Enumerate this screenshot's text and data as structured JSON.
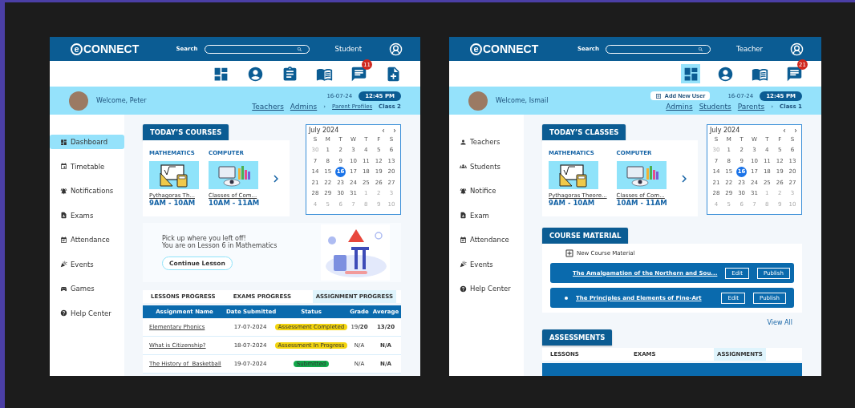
{
  "screens": [
    {
      "logo": {
        "mark": "e",
        "text": "CONNECT"
      },
      "search_label": "Search",
      "role": "Student",
      "toolbar": [
        {
          "kind": "dashboard",
          "selected": false
        },
        {
          "kind": "profile",
          "selected": false
        },
        {
          "kind": "tasks",
          "selected": false
        },
        {
          "kind": "book",
          "selected": false
        },
        {
          "kind": "chat",
          "selected": false,
          "badge": "11"
        },
        {
          "kind": "document",
          "selected": false
        }
      ],
      "welcome": "Welcome, Peter",
      "date": "16-07-24",
      "time": "12:45 PM",
      "crumbs": [
        {
          "kind": "link",
          "label": "Teachers"
        },
        {
          "kind": "link",
          "label": "Admins"
        },
        {
          "kind": "separator",
          "label": "›"
        },
        {
          "kind": "sublink",
          "label": "Parent Profiles"
        },
        {
          "kind": "text",
          "label": "Class 2"
        }
      ],
      "sidebar": [
        {
          "kind": "dashboard",
          "label": "Dashboard",
          "selected": true
        },
        {
          "kind": "timetable",
          "label": "Timetable",
          "selected": false
        },
        {
          "kind": "notifications",
          "label": "Notifications",
          "selected": false
        },
        {
          "kind": "exams",
          "label": "Exams",
          "selected": false
        },
        {
          "kind": "attendance",
          "label": "Attendance",
          "selected": false
        },
        {
          "kind": "events",
          "label": "Events",
          "selected": false
        },
        {
          "kind": "games",
          "label": "Games",
          "selected": false
        },
        {
          "kind": "help",
          "label": "Help Center",
          "selected": false
        }
      ],
      "courses": {
        "title": "TODAY’S COURSES",
        "items": [
          {
            "kind": "math",
            "subject": "MATHEMATICS",
            "title": "Pythagoras Th...",
            "time": "9AM - 10AM"
          },
          {
            "kind": "computer",
            "subject": "COMPUTER",
            "title": "Classes of Com...",
            "time": "10AM - 11AM"
          }
        ]
      },
      "calendar": {
        "month": "July 2024",
        "weekdays": [
          "S",
          "M",
          "T",
          "W",
          "T",
          "F",
          "S"
        ],
        "leading": [
          "30"
        ],
        "days": [
          {
            "label": "1",
            "selected": false
          },
          {
            "label": "2",
            "selected": false
          },
          {
            "label": "3",
            "selected": false
          },
          {
            "label": "4",
            "selected": false
          },
          {
            "label": "5",
            "selected": false
          },
          {
            "label": "6",
            "selected": false
          },
          {
            "label": "7",
            "selected": false
          },
          {
            "label": "8",
            "selected": false
          },
          {
            "label": "9",
            "selected": false
          },
          {
            "label": "10",
            "selected": false
          },
          {
            "label": "11",
            "selected": false
          },
          {
            "label": "12",
            "selected": false
          },
          {
            "label": "13",
            "selected": false
          },
          {
            "label": "14",
            "selected": false
          },
          {
            "label": "15",
            "selected": false
          },
          {
            "label": "16",
            "selected": true
          },
          {
            "label": "17",
            "selected": false
          },
          {
            "label": "18",
            "selected": false
          },
          {
            "label": "19",
            "selected": false
          },
          {
            "label": "20",
            "selected": false
          },
          {
            "label": "21",
            "selected": false
          },
          {
            "label": "22",
            "selected": false
          },
          {
            "label": "23",
            "selected": false
          },
          {
            "label": "24",
            "selected": false
          },
          {
            "label": "25",
            "selected": false
          },
          {
            "label": "26",
            "selected": false
          },
          {
            "label": "27",
            "selected": false
          },
          {
            "label": "28",
            "selected": false
          },
          {
            "label": "29",
            "selected": false
          },
          {
            "label": "30",
            "selected": false
          },
          {
            "label": "31",
            "selected": false
          }
        ],
        "trailing": [
          "1",
          "2",
          "3",
          "4",
          "5",
          "6",
          "7",
          "8",
          "9",
          "10"
        ]
      },
      "resume": {
        "lines": [
          "Pick up where you left off!",
          "You are on Lesson 6 in Mathematics"
        ],
        "button": "Continue Lesson"
      },
      "progress": {
        "tabs": [
          {
            "label": "LESSONS PROGRESS",
            "selected": false
          },
          {
            "label": "EXAMS PROGRESS",
            "selected": false
          },
          {
            "label": "ASSIGNMENT PROGRESS",
            "selected": true
          }
        ],
        "columns": [
          "Assignment Name",
          "Date Submitted",
          "Status",
          "Grade",
          "Average"
        ],
        "rows": [
          {
            "name": "Elementary Phonics",
            "date": "17-07-2024",
            "status": {
              "label": "Assessment Completed",
              "color": "#f2d40f"
            },
            "grade": "19**/20**",
            "average": "13/20"
          },
          {
            "name": "What is Citizenship?",
            "date": "18-07-2024",
            "status": {
              "label": "Assessment In Progress",
              "color": "#f2d40f"
            },
            "grade": "N/A",
            "average": "N/A"
          },
          {
            "name": "The History of  Basketball",
            "date": "19-07-2024",
            "status": {
              "label": "Submitted",
              "color": "#12a84a"
            },
            "grade": "N/A",
            "average": "N/A"
          }
        ]
      }
    },
    {
      "logo": {
        "mark": "e",
        "text": "CONNECT"
      },
      "search_label": "Search",
      "role": "Teacher",
      "toolbar": [
        {
          "kind": "dashboard",
          "selected": true
        },
        {
          "kind": "profile",
          "selected": false
        },
        {
          "kind": "book",
          "selected": false
        },
        {
          "kind": "chat",
          "selected": false,
          "badge": "21"
        }
      ],
      "welcome": "Welcome, Ismail",
      "add_user": "Add New User",
      "date": "16-07-24",
      "time": "12:45 PM",
      "crumbs": [
        {
          "kind": "link",
          "label": "Admins"
        },
        {
          "kind": "link",
          "label": "Students"
        },
        {
          "kind": "link",
          "label": "Parents"
        },
        {
          "kind": "separator",
          "label": "›"
        },
        {
          "kind": "text",
          "label": "Class 1"
        }
      ],
      "sidebar": [
        {
          "kind": "teachers",
          "label": "Teachers",
          "selected": false
        },
        {
          "kind": "students",
          "label": "Students",
          "selected": false
        },
        {
          "kind": "notifications",
          "label": "Notifice",
          "selected": false
        },
        {
          "kind": "exams",
          "label": "Exam",
          "selected": false
        },
        {
          "kind": "attendance",
          "label": "Attendance",
          "selected": false
        },
        {
          "kind": "events",
          "label": "Events",
          "selected": false
        },
        {
          "kind": "help",
          "label": "Help Center",
          "selected": false
        }
      ],
      "courses": {
        "title": "TODAY’S CLASSES",
        "items": [
          {
            "kind": "math",
            "subject": "MATHEMATICS",
            "title": "Pythagoras Theore...",
            "time": "9AM - 10AM"
          },
          {
            "kind": "computer",
            "subject": "COMPUTER",
            "title": "Classes of Com...",
            "time": "10AM - 11AM"
          }
        ]
      },
      "calendar": {
        "month": "July 2024",
        "weekdays": [
          "S",
          "M",
          "T",
          "W",
          "T",
          "F",
          "S"
        ],
        "leading": [
          "30"
        ],
        "days": [
          {
            "label": "1",
            "selected": false
          },
          {
            "label": "2",
            "selected": false
          },
          {
            "label": "3",
            "selected": false
          },
          {
            "label": "4",
            "selected": false
          },
          {
            "label": "5",
            "selected": false
          },
          {
            "label": "6",
            "selected": false
          },
          {
            "label": "7",
            "selected": false
          },
          {
            "label": "8",
            "selected": false
          },
          {
            "label": "9",
            "selected": false
          },
          {
            "label": "10",
            "selected": false
          },
          {
            "label": "11",
            "selected": false
          },
          {
            "label": "12",
            "selected": false
          },
          {
            "label": "13",
            "selected": false
          },
          {
            "label": "14",
            "selected": false
          },
          {
            "label": "15",
            "selected": false
          },
          {
            "label": "16",
            "selected": true
          },
          {
            "label": "17",
            "selected": false
          },
          {
            "label": "18",
            "selected": false
          },
          {
            "label": "19",
            "selected": false
          },
          {
            "label": "20",
            "selected": false
          },
          {
            "label": "21",
            "selected": false
          },
          {
            "label": "22",
            "selected": false
          },
          {
            "label": "23",
            "selected": false
          },
          {
            "label": "24",
            "selected": false
          },
          {
            "label": "25",
            "selected": false
          },
          {
            "label": "26",
            "selected": false
          },
          {
            "label": "27",
            "selected": false
          },
          {
            "label": "28",
            "selected": false
          },
          {
            "label": "29",
            "selected": false
          },
          {
            "label": "30",
            "selected": false
          },
          {
            "label": "31",
            "selected": false
          }
        ],
        "trailing": [
          "1",
          "2",
          "3",
          "4",
          "5",
          "6",
          "7",
          "8",
          "9",
          "10"
        ]
      },
      "material": {
        "title": "COURSE MATERIAL",
        "add_label": "New Course Material",
        "items": [
          {
            "title": "The Amalgamation of the Northern and Sou...",
            "edit": "Edit",
            "publish": "Publish"
          },
          {
            "title": "The Principles and Elements of Fine-Art",
            "edit": "Edit",
            "publish": "Publish"
          }
        ],
        "view_all": "View All"
      },
      "progress": {
        "title": "ASSESSMENTS",
        "tabs": [
          {
            "label": "LESSONS",
            "selected": false
          },
          {
            "label": "EXAMS",
            "selected": false
          },
          {
            "label": "ASSIGNMENTS",
            "selected": true
          }
        ]
      }
    }
  ]
}
